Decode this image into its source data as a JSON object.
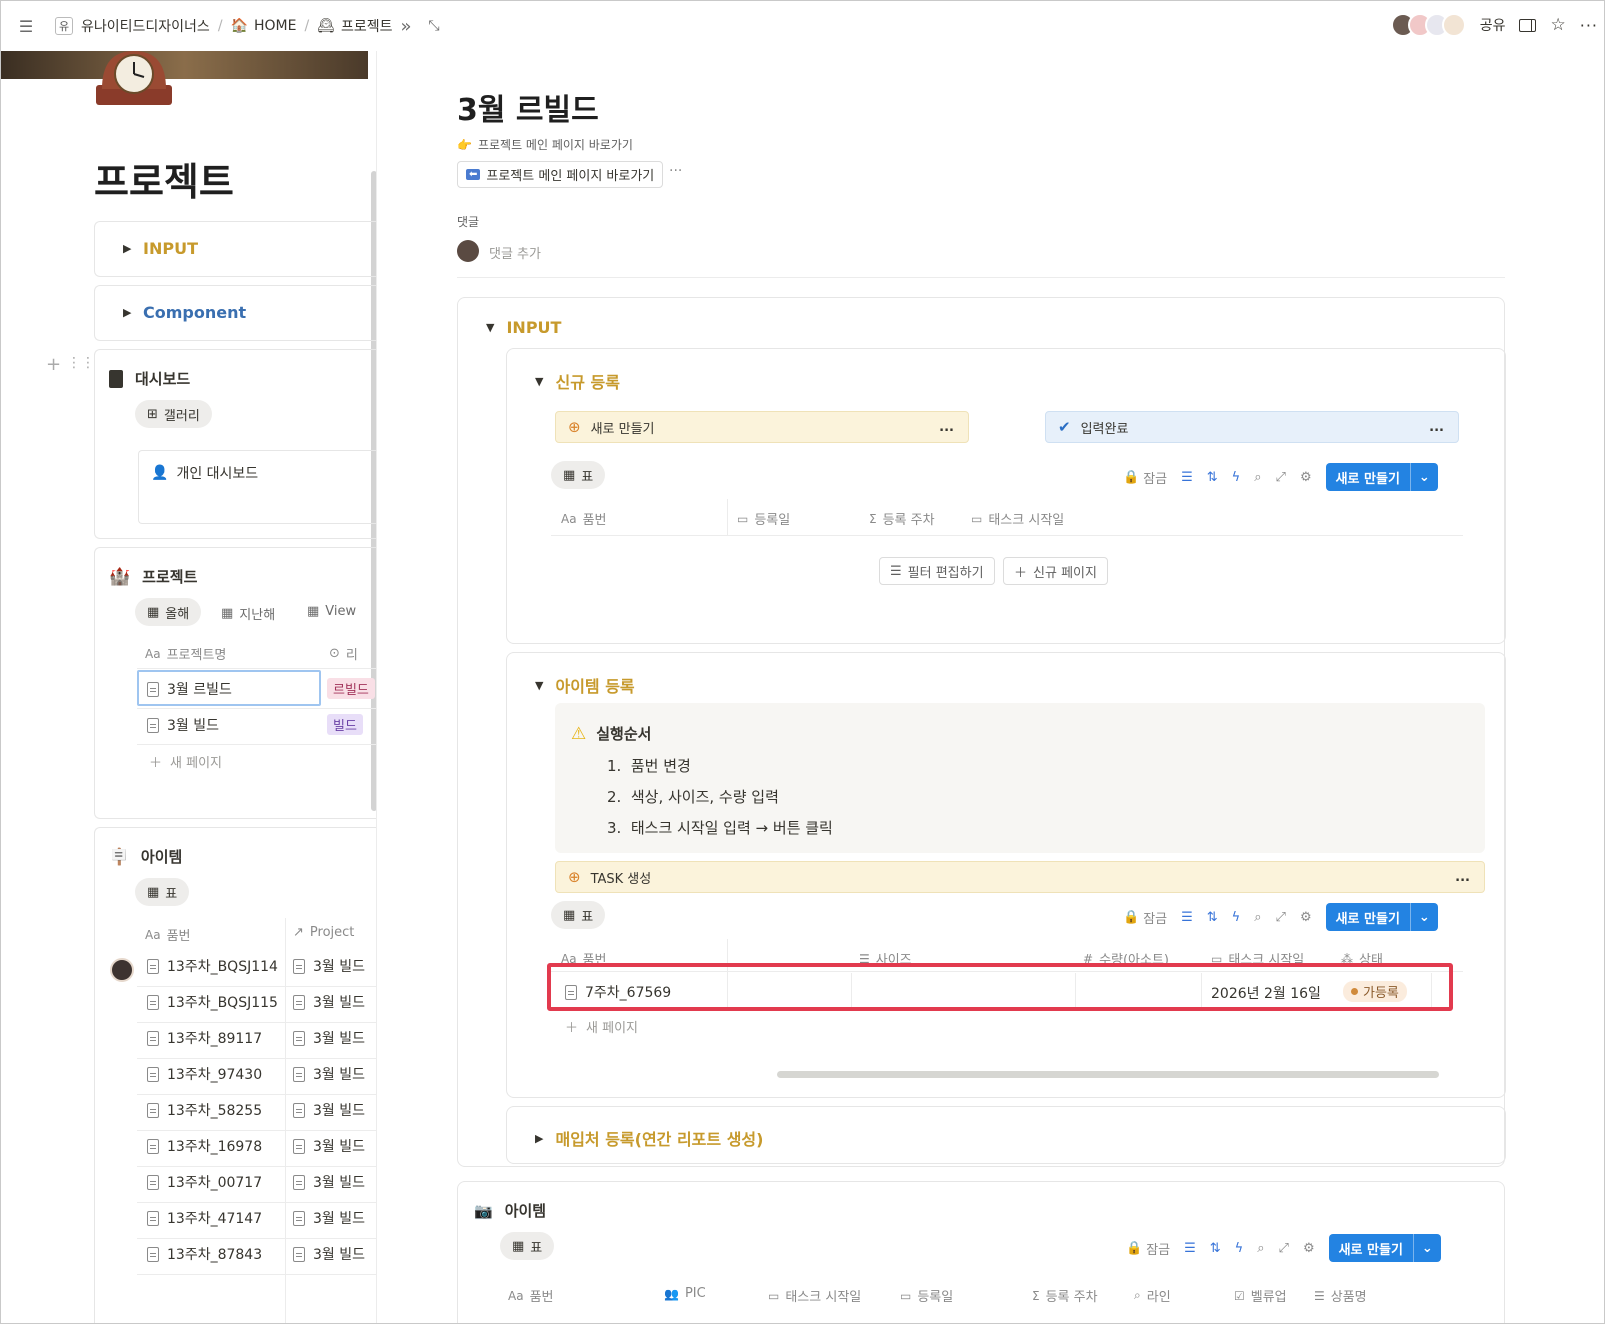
{
  "topbar": {
    "workspace_initial": "유",
    "breadcrumbs": [
      "유나이티드디자이너스",
      "HOME",
      "프로젝트"
    ],
    "share_label": "공유"
  },
  "left": {
    "title": "프로젝트",
    "toggle_input": "INPUT",
    "toggle_component": "Component",
    "dashboard": {
      "heading": "대시보드",
      "tab": "갤러리",
      "card": "개인 대시보드"
    },
    "projects": {
      "heading": "프로젝트",
      "tabs": [
        "올해",
        "지난해",
        "View"
      ],
      "col_name": "프로젝트명",
      "col_second": "리",
      "rows": [
        {
          "name": "3월 르빌드",
          "tag": "르빌드"
        },
        {
          "name": "3월 빌드",
          "tag": "빌드"
        }
      ],
      "new_page": "새 페이지"
    },
    "items": {
      "heading": "아이템",
      "tab": "표",
      "col_name": "품번",
      "col_project": "Project",
      "rows": [
        {
          "name": "13주차_BQSJ114",
          "project": "3월 빌드"
        },
        {
          "name": "13주차_BQSJ115",
          "project": "3월 빌드"
        },
        {
          "name": "13주차_89117",
          "project": "3월 빌드"
        },
        {
          "name": "13주차_97430",
          "project": "3월 빌드"
        },
        {
          "name": "13주차_58255",
          "project": "3월 빌드"
        },
        {
          "name": "13주차_16978",
          "project": "3월 빌드"
        },
        {
          "name": "13주차_00717",
          "project": "3월 빌드"
        },
        {
          "name": "13주차_47147",
          "project": "3월 빌드"
        },
        {
          "name": "13주차_87843",
          "project": "3월 빌드"
        }
      ]
    }
  },
  "main": {
    "title": "3월 르빌드",
    "link_label": "프로젝트 메인 페이지 바로가기",
    "link_button": "프로젝트 메인 페이지 바로가기",
    "comments_label": "댓글",
    "add_comment": "댓글 추가",
    "input_section": "INPUT",
    "new_reg": {
      "title": "신규 등록",
      "btn_new": "새로 만들기",
      "btn_done": "입력완료",
      "tab": "표",
      "lock": "잠금",
      "new_button": "새로 만들기",
      "columns": [
        "품번",
        "등록일",
        "등록 주차",
        "태스크 시작일"
      ],
      "filter_btn": "필터 편집하기",
      "new_page_btn": "신규 페이지"
    },
    "item_reg": {
      "title": "아이템 등록",
      "callout_title": "실행순서",
      "steps": [
        "1.  품번 변경",
        "2.  색상, 사이즈, 수량 입력",
        "3.  태스크 시작일 입력 → 버튼 클릭"
      ],
      "task_btn": "TASK 생성",
      "tab": "표",
      "lock": "잠금",
      "new_button": "새로 만들기",
      "columns": [
        "품번",
        "사이즈",
        "수량(아소트)",
        "태스크 시작일",
        "상태"
      ],
      "row": {
        "name": "7주차_67569",
        "date": "2026년 2월 16일",
        "status": "가등록"
      },
      "new_page": "새 페이지"
    },
    "purchase": "매입처 등록(연간 리포트 생성)",
    "items_section": {
      "title": "아이템",
      "tab": "표",
      "lock": "잠금",
      "new_button": "새로 만들기",
      "columns": [
        "품번",
        "PIC",
        "태스크 시작일",
        "등록일",
        "등록 주차",
        "라인",
        "벨류업",
        "상품명"
      ]
    }
  },
  "colors": {
    "accent": "#2383e2",
    "gold": "#c79a2c",
    "highlight": "#e23a4e"
  }
}
